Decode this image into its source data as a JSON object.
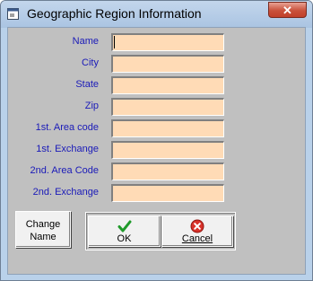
{
  "window": {
    "title": "Geographic Region Information",
    "close_glyph": "✕"
  },
  "fields": [
    {
      "label": "Name",
      "value": ""
    },
    {
      "label": "City",
      "value": ""
    },
    {
      "label": "State",
      "value": ""
    },
    {
      "label": "Zip",
      "value": ""
    },
    {
      "label": "1st. Area code",
      "value": ""
    },
    {
      "label": "1st. Exchange",
      "value": ""
    },
    {
      "label": "2nd. Area Code",
      "value": ""
    },
    {
      "label": "2nd. Exchange",
      "value": ""
    }
  ],
  "buttons": {
    "change_name_line1": "Change",
    "change_name_line2": "Name",
    "ok": "OK",
    "cancel": "Cancel"
  },
  "colors": {
    "input_bg": "#ffdbb6",
    "label_text": "#1a1ab8",
    "form_bg": "#c0c0c0"
  },
  "icons": {
    "ok": "green-checkmark-icon",
    "cancel": "red-x-circle-icon"
  }
}
